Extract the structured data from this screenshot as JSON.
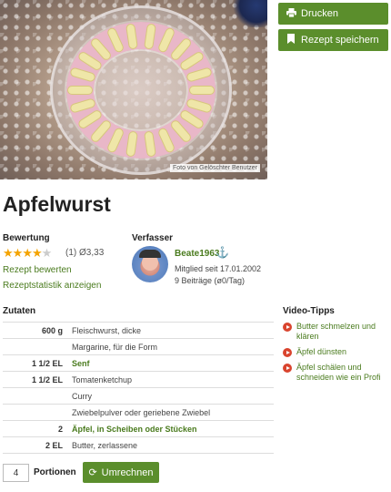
{
  "photo": {
    "credit": "Foto von Gelöschter Benutzer"
  },
  "actions": {
    "print_label": "Drucken",
    "save_label": "Rezept speichern"
  },
  "recipe": {
    "title": "Apfelwurst"
  },
  "rating": {
    "heading": "Bewertung",
    "stars_value": 3.33,
    "stars_max": 5,
    "count_text": "(1)",
    "avg_text": "Ø3,33",
    "rate_link": "Rezept bewerten",
    "stats_link": "Rezeptstatistik anzeigen"
  },
  "author": {
    "heading": "Verfasser",
    "name": "Beate1963",
    "member_since": "Mitglied seit 17.01.2002",
    "posts": "9 Beiträge (ø0/Tag)"
  },
  "ingredients": {
    "heading": "Zutaten",
    "rows": [
      {
        "amount": "600 g",
        "name": "Fleischwurst, dicke",
        "link": false
      },
      {
        "amount": "",
        "name": "Margarine, für die Form",
        "link": false
      },
      {
        "amount": "1 1/2 EL",
        "name": "Senf",
        "link": true
      },
      {
        "amount": "1 1/2 EL",
        "name": "Tomatenketchup",
        "link": false
      },
      {
        "amount": "",
        "name": "Curry",
        "link": false
      },
      {
        "amount": "",
        "name": "Zwiebelpulver oder geriebene Zwiebel",
        "link": false
      },
      {
        "amount": "2",
        "name": "Äpfel, in Scheiben oder Stücken",
        "link": true
      },
      {
        "amount": "2 EL",
        "name": "Butter, zerlassene",
        "link": false
      }
    ]
  },
  "portions": {
    "value": "4",
    "label": "Portionen",
    "recalc_label": "Umrechnen"
  },
  "video_tips": {
    "heading": "Video-Tipps",
    "items": [
      "Butter schmelzen und klären",
      "Äpfel dünsten",
      "Äpfel schälen und schneiden wie ein Profi"
    ]
  },
  "colors": {
    "accent": "#5b8e2c",
    "link": "#4a7b1e",
    "star": "#f4a300",
    "play": "#d9442e"
  }
}
